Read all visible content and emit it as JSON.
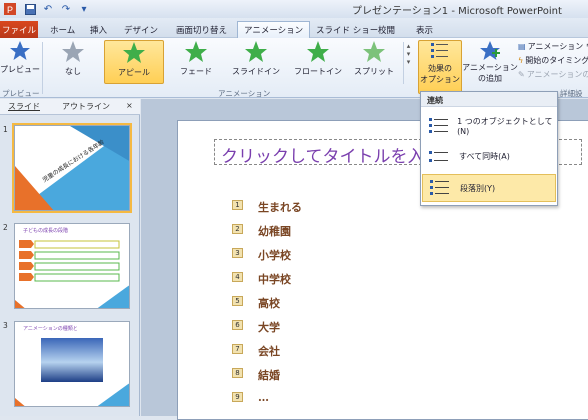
{
  "window": {
    "title": "プレゼンテーション1 - Microsoft PowerPoint"
  },
  "qat": {
    "save_icon": "save-icon",
    "undo_icon": "undo-icon",
    "redo_icon": "redo-icon"
  },
  "tabs": [
    "ファイル",
    "ホーム",
    "挿入",
    "デザイン",
    "画面切り替え",
    "アニメーション",
    "スライド ショー",
    "校閲",
    "表示"
  ],
  "ribbon": {
    "preview": {
      "label": "プレビュー"
    },
    "animations": [
      {
        "label": "なし",
        "color": "#9aa5b4"
      },
      {
        "label": "アピール",
        "color": "#3fae4a"
      },
      {
        "label": "フェード",
        "color": "#3fae4a"
      },
      {
        "label": "スライドイン",
        "color": "#3fae4a"
      },
      {
        "label": "フロートイン",
        "color": "#3fae4a"
      },
      {
        "label": "スプリット",
        "color": "#3fae4a"
      }
    ],
    "groups": {
      "preview": "プレビュー",
      "animation": "アニメーション"
    },
    "effect_options": {
      "line1": "効果の",
      "line2": "オプション"
    },
    "add_animation": {
      "line1": "アニメーション",
      "line2": "の追加"
    },
    "small_cmds": [
      "アニメーション ウ",
      "開始のタイミング",
      "アニメーションのコ"
    ],
    "timing_label": "詳細設"
  },
  "leftpane": {
    "tabs": {
      "slides": "スライド",
      "outline": "アウトライン",
      "close": "×"
    },
    "slide_numbers": [
      "1",
      "2",
      "3"
    ],
    "thumb1_title": "児童の成長における各年齢",
    "thumb2_title": "子どもの成長の段階",
    "thumb3_title": "アニメーションの種類と"
  },
  "slide": {
    "title": "クリックしてタイトルを入",
    "bullets": [
      {
        "num": "1",
        "text": "生まれる"
      },
      {
        "num": "2",
        "text": "幼稚園"
      },
      {
        "num": "3",
        "text": "小学校"
      },
      {
        "num": "4",
        "text": "中学校"
      },
      {
        "num": "5",
        "text": "高校"
      },
      {
        "num": "6",
        "text": "大学"
      },
      {
        "num": "7",
        "text": "会社"
      },
      {
        "num": "8",
        "text": "結婚"
      },
      {
        "num": "9",
        "text": "…"
      }
    ]
  },
  "dropdown": {
    "header": "連続",
    "items": [
      {
        "label": "1 つのオブジェクトとして(N)",
        "selected": false
      },
      {
        "label": "すべて同時(A)",
        "selected": false
      },
      {
        "label": "段落別(Y)",
        "selected": true
      }
    ]
  },
  "colors": {
    "accent": "#f5b942",
    "brand": "#d9481f",
    "title": "#7a3fae"
  }
}
